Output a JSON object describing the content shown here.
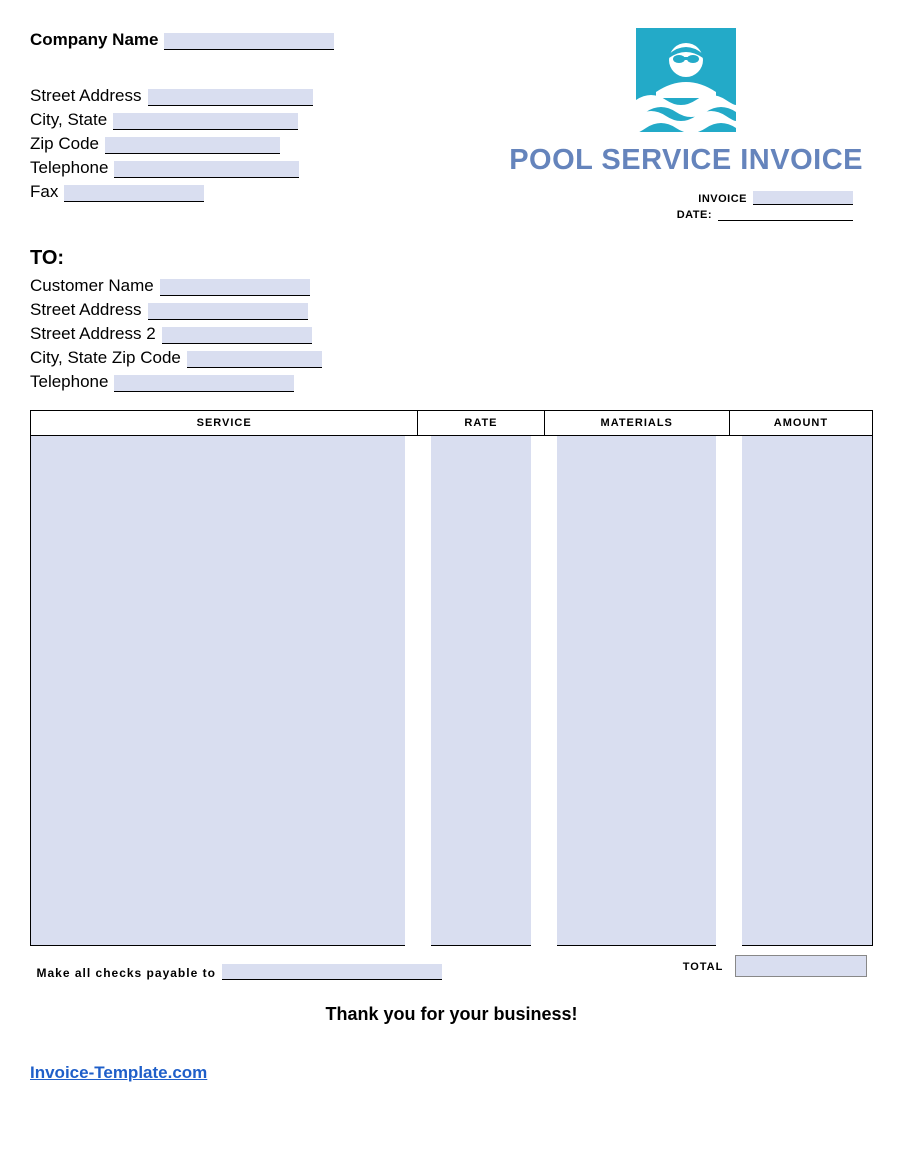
{
  "header": {
    "company_name_label": "Company Name",
    "street_label": "Street Address",
    "city_state_label": "City, State",
    "zip_label": "Zip Code",
    "telephone_label": "Telephone",
    "fax_label": "Fax",
    "brand_title": "POOL SERVICE INVOICE",
    "invoice_label": "INVOICE",
    "date_label": "DATE:"
  },
  "to": {
    "heading": "TO:",
    "customer_name_label": "Customer Name",
    "street1_label": "Street Address",
    "street2_label": "Street Address 2",
    "citystatezip_label": "City, State Zip Code",
    "telephone_label": "Telephone"
  },
  "table": {
    "col_service": "SERVICE",
    "col_rate": "RATE",
    "col_materials": "MATERIALS",
    "col_amount": "AMOUNT",
    "total_label": "TOTAL"
  },
  "footer": {
    "payable_label": "Make all checks payable to",
    "thanks": "Thank you for your business!",
    "link_text": "Invoice-Template.com"
  }
}
